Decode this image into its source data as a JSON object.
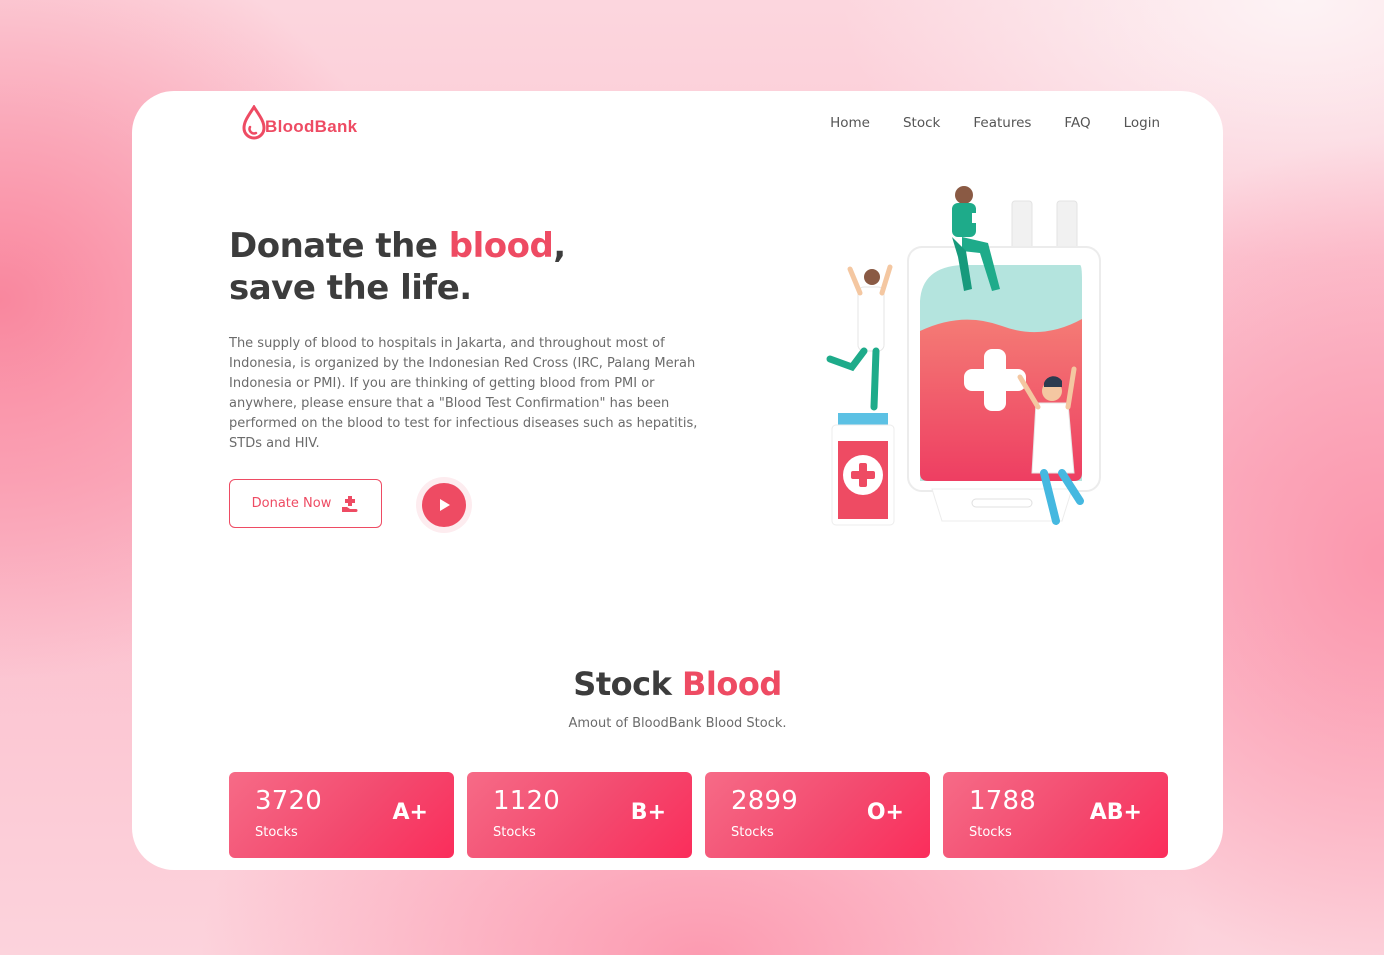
{
  "brand": {
    "name": "BloodBank",
    "logo_icon": "blood-drop-icon",
    "accent_color": "#ee4b63"
  },
  "nav": {
    "items": [
      {
        "label": "Home"
      },
      {
        "label": "Stock"
      },
      {
        "label": "Features"
      },
      {
        "label": "FAQ"
      },
      {
        "label": "Login"
      }
    ]
  },
  "hero": {
    "title_part1": "Donate the ",
    "title_accent": "blood",
    "title_part2": ",",
    "title_line2": "save the life.",
    "description": "The supply of blood to hospitals in Jakarta, and throughout most of Indonesia, is organized by the Indonesian Red Cross (IRC, Palang Merah Indonesia or PMI). If you are thinking of getting blood from PMI or anywhere, please ensure that a \"Blood Test Confirmation\" has been performed on the blood to test for infectious diseases such as hepatitis, STDs and HIV.",
    "donate_label": "Donate Now",
    "donate_icon": "hand-donate-icon",
    "play_icon": "play-icon"
  },
  "stock": {
    "title_part1": "Stock ",
    "title_accent": "Blood",
    "subtitle": "Amout of BloodBank Blood Stock.",
    "cards": [
      {
        "count": "3720",
        "unit": "Stocks",
        "type": "A+"
      },
      {
        "count": "1120",
        "unit": "Stocks",
        "type": "B+"
      },
      {
        "count": "2899",
        "unit": "Stocks",
        "type": "O+"
      },
      {
        "count": "1788",
        "unit": "Stocks",
        "type": "AB+"
      }
    ]
  }
}
